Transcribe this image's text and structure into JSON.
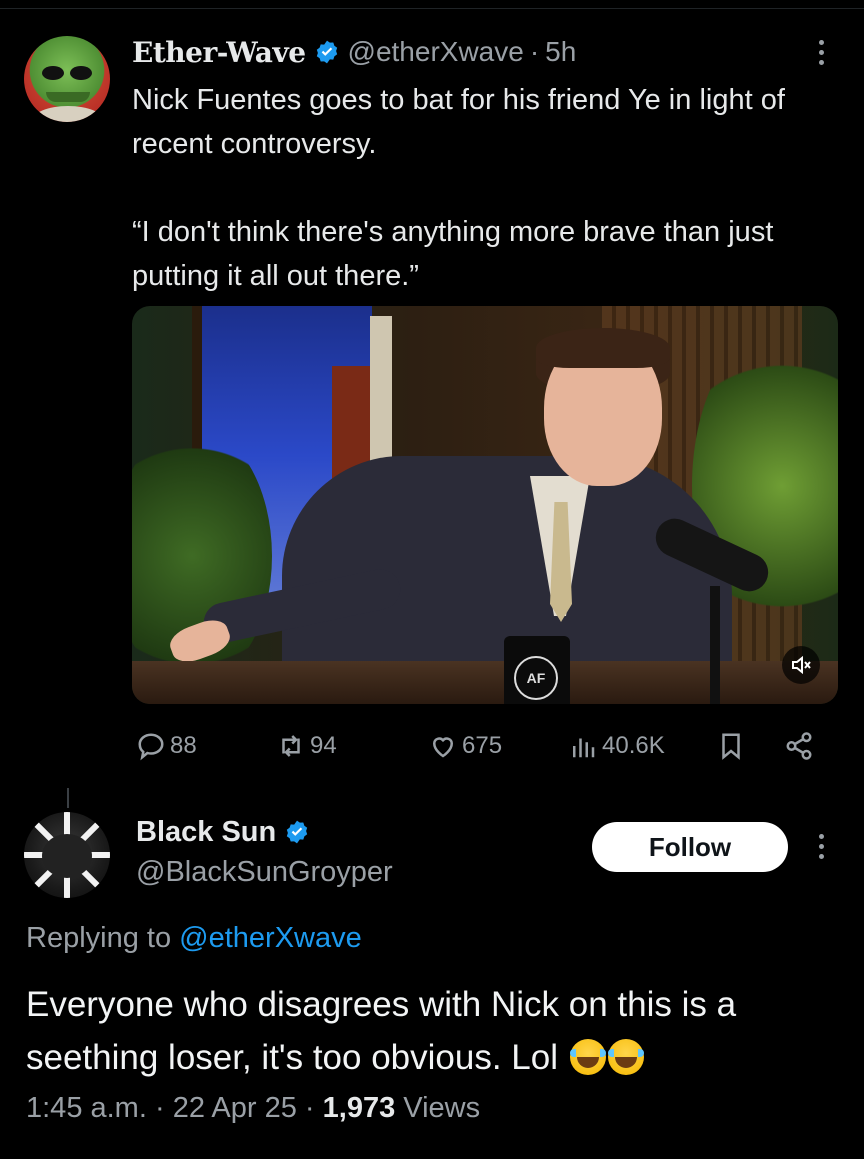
{
  "tweet": {
    "author_name": "Ether-Wave",
    "handle": "@etherXwave",
    "separator": "·",
    "time": "5h",
    "text_line1": "Nick Fuentes goes to bat for his friend Ye in light of recent controversy.",
    "quote": "“I don't think there's anything more brave than just putting it all out there.”",
    "media": {
      "mug_logo": "AF",
      "mute_icon": "speaker-muted-icon"
    },
    "actions": {
      "replies": "88",
      "reposts": "94",
      "likes": "675",
      "views": "40.6K"
    }
  },
  "reply": {
    "author_name": "Black Sun",
    "handle": "@BlackSunGroyper",
    "follow_label": "Follow",
    "replying_prefix": "Replying to",
    "replying_to": "@etherXwave",
    "text": "Everyone who disagrees with Nick on this is a seething loser, it's too obvious. Lol",
    "emoji_name": "face-with-tears-of-joy",
    "time": "1:45 a.m.",
    "date": "22 Apr 25",
    "views_count": "1,973",
    "views_label": "Views",
    "dot": "·"
  },
  "colors": {
    "background": "#000000",
    "text": "#e7e9ea",
    "muted": "#9aa0a6",
    "accent": "#1d9bf0"
  }
}
